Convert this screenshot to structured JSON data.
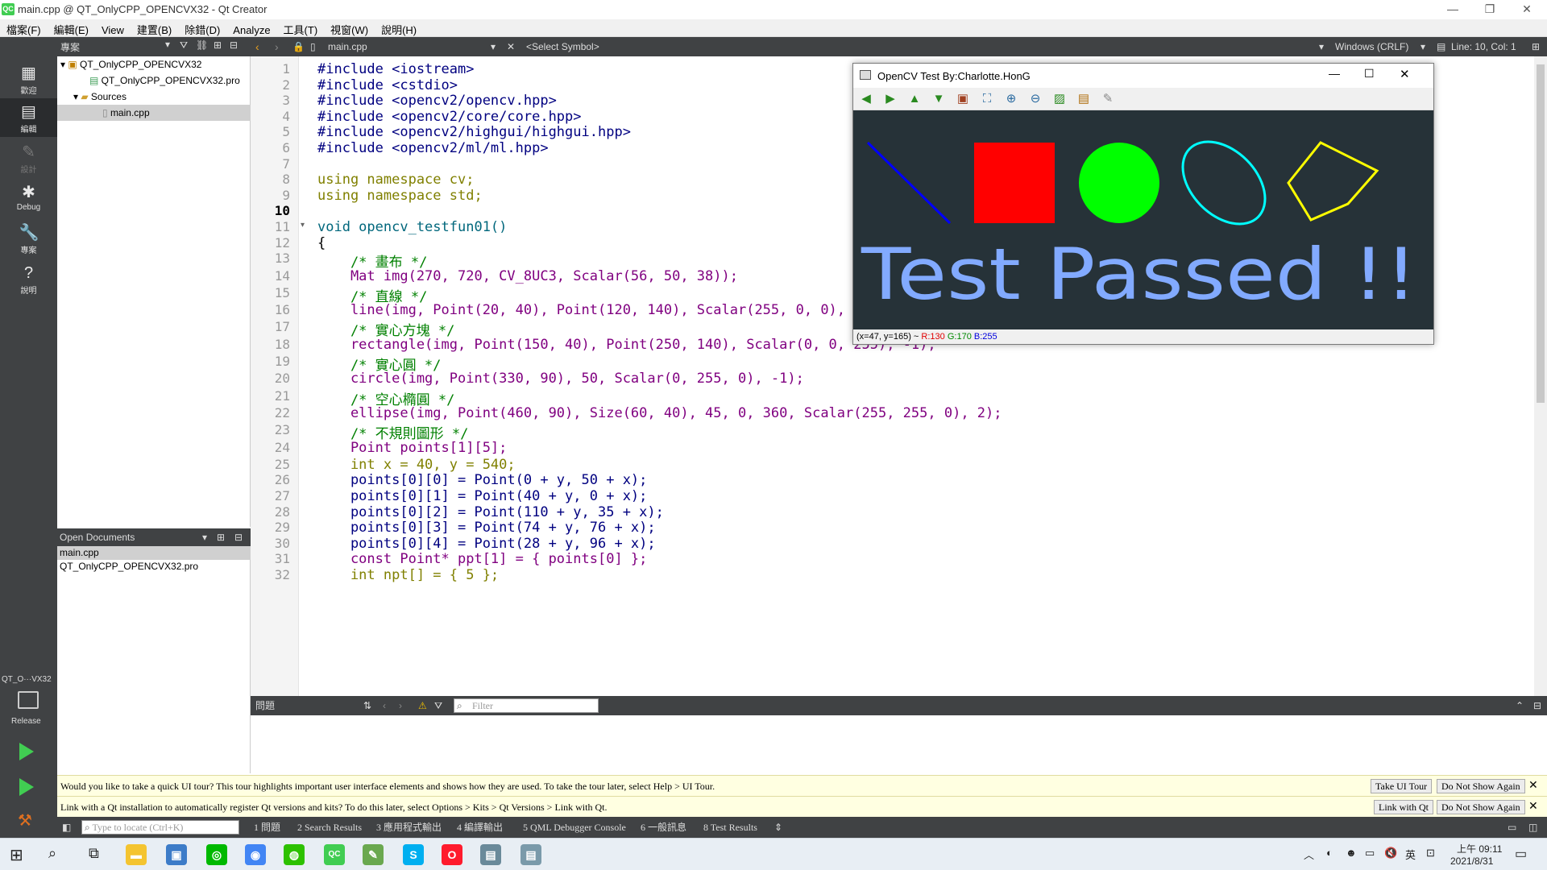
{
  "window": {
    "title": "main.cpp @ QT_OnlyCPP_OPENCVX32 - Qt Creator",
    "app_icon": "QC",
    "minimize": "—",
    "maximize": "❐",
    "close": "✕"
  },
  "menu": [
    "檔案(F)",
    "編輯(E)",
    "View",
    "建置(B)",
    "除錯(D)",
    "Analyze",
    "工具(T)",
    "視窗(W)",
    "說明(H)"
  ],
  "modes": [
    {
      "label": "歡迎",
      "icon": "grid-icon"
    },
    {
      "label": "編輯",
      "icon": "edit-icon"
    },
    {
      "label": "設計",
      "icon": "design-icon"
    },
    {
      "label": "Debug",
      "icon": "debug-icon"
    },
    {
      "label": "專案",
      "icon": "wrench-icon"
    },
    {
      "label": "說明",
      "icon": "help-icon"
    }
  ],
  "kit": {
    "project_short": "QT_O···VX32",
    "build": "Release"
  },
  "project_panel": {
    "title": "專案",
    "tree": [
      "QT_OnlyCPP_OPENCVX32",
      "QT_OnlyCPP_OPENCVX32.pro",
      "Sources",
      "main.cpp"
    ]
  },
  "open_documents": {
    "title": "Open Documents",
    "items": [
      "main.cpp",
      "QT_OnlyCPP_OPENCVX32.pro"
    ]
  },
  "editor_bar": {
    "file": "main.cpp",
    "symbol": "<Select Symbol>",
    "line_ending": "Windows (CRLF)",
    "position": "Line: 10, Col: 1"
  },
  "code_lines": [
    {
      "n": "1",
      "t": "#include <iostream>"
    },
    {
      "n": "2",
      "t": "#include <cstdio>"
    },
    {
      "n": "3",
      "t": "#include <opencv2/opencv.hpp>"
    },
    {
      "n": "4",
      "t": "#include <opencv2/core/core.hpp>"
    },
    {
      "n": "5",
      "t": "#include <opencv2/highgui/highgui.hpp>"
    },
    {
      "n": "6",
      "t": "#include <opencv2/ml/ml.hpp>"
    },
    {
      "n": "7",
      "t": ""
    },
    {
      "n": "8",
      "t": "using namespace cv;"
    },
    {
      "n": "9",
      "t": "using namespace std;"
    },
    {
      "n": "10",
      "t": ""
    },
    {
      "n": "11",
      "t": "void opencv_testfun01()"
    },
    {
      "n": "12",
      "t": "{"
    },
    {
      "n": "13",
      "t": "    /* 畫布 */"
    },
    {
      "n": "14",
      "t": "    Mat img(270, 720, CV_8UC3, Scalar(56, 50, 38));"
    },
    {
      "n": "15",
      "t": "    /* 直線 */"
    },
    {
      "n": "16",
      "t": "    line(img, Point(20, 40), Point(120, 140), Scalar(255, 0, 0), 3);"
    },
    {
      "n": "17",
      "t": "    /* 實心方塊 */"
    },
    {
      "n": "18",
      "t": "    rectangle(img, Point(150, 40), Point(250, 140), Scalar(0, 0, 255), -1);"
    },
    {
      "n": "19",
      "t": "    /* 實心圓 */"
    },
    {
      "n": "20",
      "t": "    circle(img, Point(330, 90), 50, Scalar(0, 255, 0), -1);"
    },
    {
      "n": "21",
      "t": "    /* 空心橢圓 */"
    },
    {
      "n": "22",
      "t": "    ellipse(img, Point(460, 90), Size(60, 40), 45, 0, 360, Scalar(255, 255, 0), 2);"
    },
    {
      "n": "23",
      "t": "    /* 不規則圖形 */"
    },
    {
      "n": "24",
      "t": "    Point points[1][5];"
    },
    {
      "n": "25",
      "t": "    int x = 40, y = 540;"
    },
    {
      "n": "26",
      "t": "    points[0][0] = Point(0 + y, 50 + x);"
    },
    {
      "n": "27",
      "t": "    points[0][1] = Point(40 + y, 0 + x);"
    },
    {
      "n": "28",
      "t": "    points[0][2] = Point(110 + y, 35 + x);"
    },
    {
      "n": "29",
      "t": "    points[0][3] = Point(74 + y, 76 + x);"
    },
    {
      "n": "30",
      "t": "    points[0][4] = Point(28 + y, 96 + x);"
    },
    {
      "n": "31",
      "t": "    const Point* ppt[1] = { points[0] };"
    },
    {
      "n": "32",
      "t": "    int npt[] = { 5 };"
    }
  ],
  "opencv_window": {
    "title": "OpenCV Test By:Charlotte.HonG",
    "canvas_text": "Test Passed !!",
    "status_prefix": "(x=47, y=165) ~ ",
    "status_r": "R:130",
    "status_g": "G:170",
    "status_b": "B:255",
    "colors": {
      "bg": "#263238",
      "line": "#0000ff",
      "rect": "#ff0000",
      "circle": "#00ff00",
      "ellipse": "#00ffff",
      "polygon": "#ffff00",
      "text": "#82aaff"
    }
  },
  "issues": {
    "title": "問題",
    "filter_placeholder": "Filter"
  },
  "info_bars": [
    {
      "text": "Would you like to take a quick UI tour? This tour highlights important user interface elements and shows how they are used. To take the tour later, select Help > UI Tour.",
      "btn1": "Take UI Tour",
      "btn2": "Do Not Show Again"
    },
    {
      "text": "Link with a Qt installation to automatically register Qt versions and kits? To do this later, select Options > Kits > Qt Versions > Link with Qt.",
      "btn1": "Link with Qt",
      "btn2": "Do Not Show Again"
    }
  ],
  "output_tabs": {
    "locate_placeholder": "Type to locate (Ctrl+K)",
    "tabs": [
      "1 問題",
      "2 Search Results",
      "3 應用程式輸出",
      "4 編譯輸出",
      "5 QML Debugger Console",
      "6 一般訊息",
      "8 Test Results"
    ]
  },
  "taskbar": {
    "ime": "英",
    "time": "上午 09:11",
    "date": "2021/8/31"
  }
}
